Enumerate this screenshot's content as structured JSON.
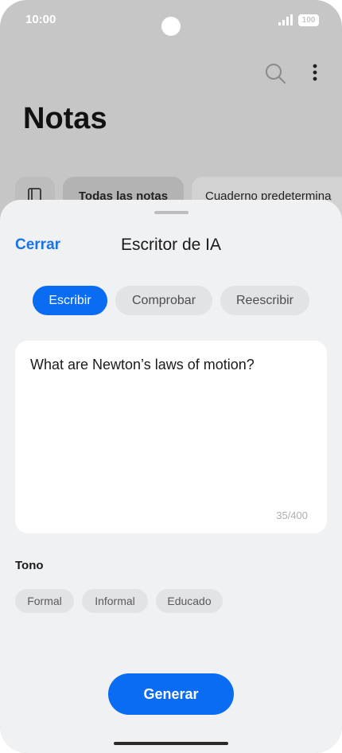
{
  "status_bar": {
    "time": "10:00",
    "battery": "100",
    "icons": [
      "signal-icon",
      "battery-icon"
    ]
  },
  "background_app": {
    "title": "Notas",
    "icons": [
      "search-icon",
      "more-vertical-icon",
      "notebook-icon"
    ],
    "chips": {
      "all_notes": "Todas las notas",
      "default_notebook": "Cuaderno predetermina"
    }
  },
  "sheet": {
    "close_label": "Cerrar",
    "title": "Escritor de IA",
    "tabs": [
      {
        "label": "Escribir",
        "selected": true
      },
      {
        "label": "Comprobar",
        "selected": false
      },
      {
        "label": "Reescribir",
        "selected": false
      }
    ],
    "prompt": {
      "text": "What are Newton’s laws of motion?",
      "char_count": "35/400"
    },
    "tone": {
      "label": "Tono",
      "options": [
        "Formal",
        "Informal",
        "Educado"
      ]
    },
    "generate_label": "Generar"
  },
  "colors": {
    "accent": "#0A6BF3",
    "link": "#1973E6",
    "scrim": "#C6C6C7",
    "sheet_bg": "#F0F1F3"
  }
}
